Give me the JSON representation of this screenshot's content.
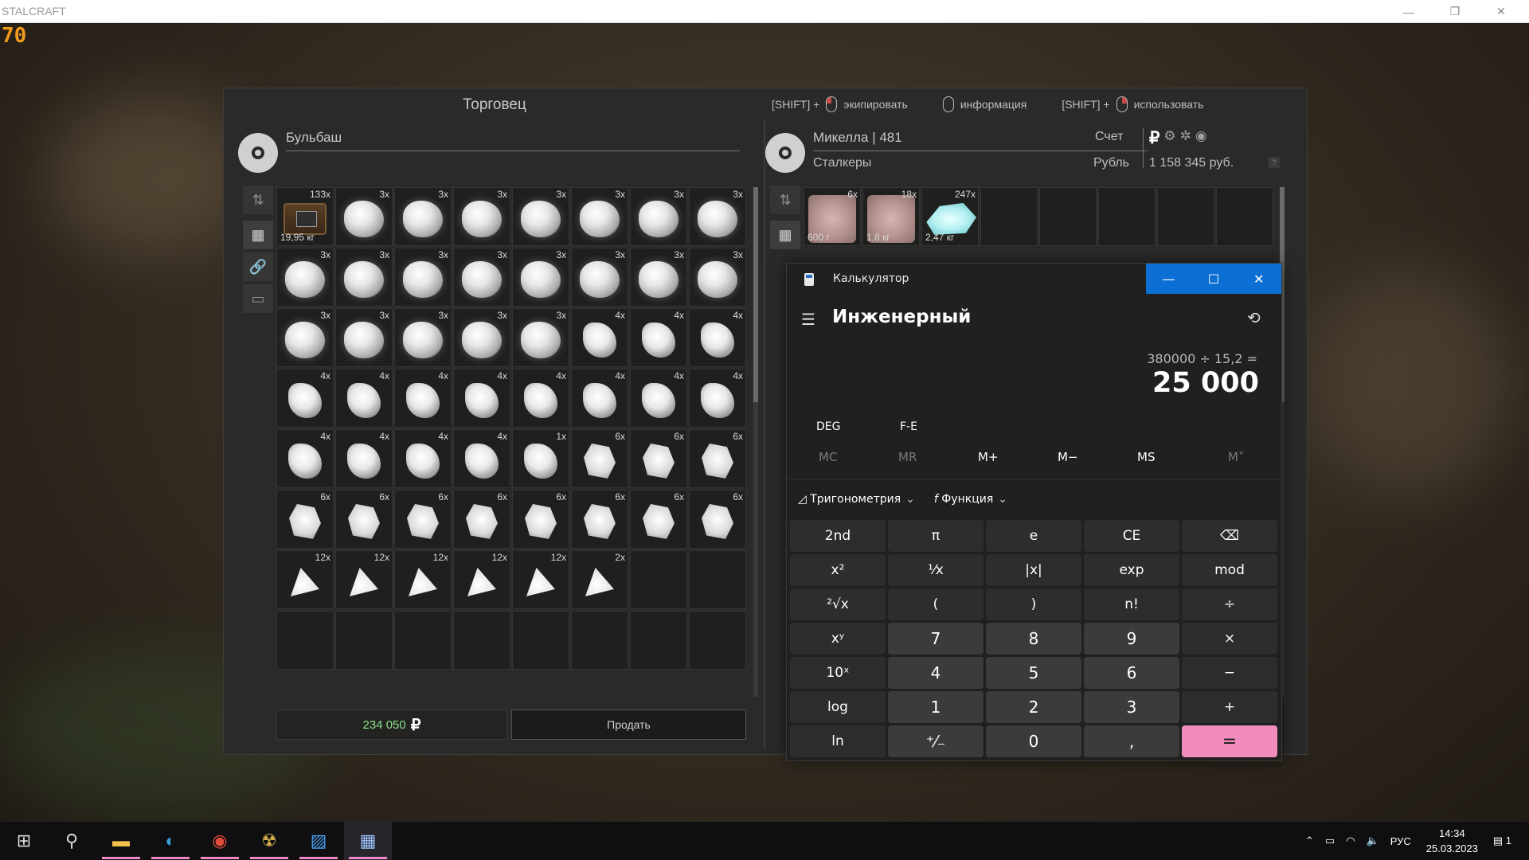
{
  "window": {
    "title": "STALCRAFT",
    "fps": "70",
    "buttons": [
      "—",
      "❐",
      "✕"
    ]
  },
  "trader": {
    "title": "Торговец",
    "npc_name": "Бульбаш",
    "total_price": "234 050",
    "currency_symbol": "₽",
    "sell_label": "Продать"
  },
  "hints": [
    {
      "prefix": "[SHIFT] +",
      "mouse": "left",
      "label": "экипировать"
    },
    {
      "prefix": "",
      "mouse": "none",
      "label": "информация"
    },
    {
      "prefix": "[SHIFT] +",
      "mouse": "right",
      "label": "использовать"
    }
  ],
  "trader_inventory": [
    {
      "kind": "box",
      "count": "133x",
      "weight": "19,95 кг"
    },
    {
      "kind": "rock",
      "count": "3x"
    },
    {
      "kind": "rock",
      "count": "3x"
    },
    {
      "kind": "rock",
      "count": "3x"
    },
    {
      "kind": "rock",
      "count": "3x"
    },
    {
      "kind": "rock",
      "count": "3x"
    },
    {
      "kind": "rock",
      "count": "3x"
    },
    {
      "kind": "rock",
      "count": "3x"
    },
    {
      "kind": "rock",
      "count": "3x"
    },
    {
      "kind": "rock",
      "count": "3x"
    },
    {
      "kind": "rock",
      "count": "3x"
    },
    {
      "kind": "rock",
      "count": "3x"
    },
    {
      "kind": "rock",
      "count": "3x"
    },
    {
      "kind": "rock",
      "count": "3x"
    },
    {
      "kind": "rock",
      "count": "3x"
    },
    {
      "kind": "rock",
      "count": "3x"
    },
    {
      "kind": "rock",
      "count": "3x"
    },
    {
      "kind": "rock",
      "count": "3x"
    },
    {
      "kind": "rock",
      "count": "3x"
    },
    {
      "kind": "rock",
      "count": "3x"
    },
    {
      "kind": "rock",
      "count": "3x"
    },
    {
      "kind": "shard",
      "count": "4x"
    },
    {
      "kind": "shard",
      "count": "4x"
    },
    {
      "kind": "shard",
      "count": "4x"
    },
    {
      "kind": "shard",
      "count": "4x"
    },
    {
      "kind": "shard",
      "count": "4x"
    },
    {
      "kind": "shard",
      "count": "4x"
    },
    {
      "kind": "shard",
      "count": "4x"
    },
    {
      "kind": "shard",
      "count": "4x"
    },
    {
      "kind": "shard",
      "count": "4x"
    },
    {
      "kind": "shard",
      "count": "4x"
    },
    {
      "kind": "shard",
      "count": "4x"
    },
    {
      "kind": "shard",
      "count": "4x"
    },
    {
      "kind": "shard",
      "count": "4x"
    },
    {
      "kind": "shard",
      "count": "4x"
    },
    {
      "kind": "shard",
      "count": "4x"
    },
    {
      "kind": "shard",
      "count": "1x"
    },
    {
      "kind": "chunk",
      "count": "6x"
    },
    {
      "kind": "chunk",
      "count": "6x"
    },
    {
      "kind": "chunk",
      "count": "6x"
    },
    {
      "kind": "chunk",
      "count": "6x"
    },
    {
      "kind": "chunk",
      "count": "6x"
    },
    {
      "kind": "chunk",
      "count": "6x"
    },
    {
      "kind": "chunk",
      "count": "6x"
    },
    {
      "kind": "chunk",
      "count": "6x"
    },
    {
      "kind": "chunk",
      "count": "6x"
    },
    {
      "kind": "chunk",
      "count": "6x"
    },
    {
      "kind": "chunk",
      "count": "6x"
    },
    {
      "kind": "tri",
      "count": "12x"
    },
    {
      "kind": "tri",
      "count": "12x"
    },
    {
      "kind": "tri",
      "count": "12x"
    },
    {
      "kind": "tri",
      "count": "12x"
    },
    {
      "kind": "tri",
      "count": "12x"
    },
    {
      "kind": "tri",
      "count": "2x"
    }
  ],
  "player": {
    "name": "Микелла | 481",
    "group": "Сталкеры",
    "account_label": "Счет",
    "currency_label": "Рубль",
    "balance": "1 158 345 руб.",
    "help": "?"
  },
  "player_inventory": [
    {
      "kind": "pink",
      "count": "6x",
      "weight": "600 г"
    },
    {
      "kind": "pink",
      "count": "18x",
      "weight": "1,8 кг"
    },
    {
      "kind": "crystal",
      "count": "247x",
      "weight": "2,47 кг"
    }
  ],
  "calculator": {
    "app_title": "Калькулятор",
    "mode": "Инженерный",
    "expression": "380000 ÷ 15,2 =",
    "display": "25 000",
    "deg": "DEG",
    "fe": "F-E",
    "memory": [
      "MC",
      "MR",
      "M+",
      "M−",
      "MS",
      "M˅"
    ],
    "trig_label": "Тригонометрия",
    "func_label": "Функция",
    "keys": [
      "2nd",
      "π",
      "e",
      "CE",
      "⌫",
      "x²",
      "¹⁄x",
      "|x|",
      "exp",
      "mod",
      "²√x",
      "(",
      ")",
      "n!",
      "÷",
      "xʸ",
      "7",
      "8",
      "9",
      "×",
      "10ˣ",
      "4",
      "5",
      "6",
      "−",
      "log",
      "1",
      "2",
      "3",
      "+",
      "ln",
      "⁺⁄₋",
      "0",
      ",",
      "="
    ]
  },
  "taskbar": {
    "apps": [
      "windows-start",
      "search",
      "file-explorer",
      "edge",
      "chrome",
      "stalcraft",
      "photos",
      "calculator"
    ],
    "language": "РУС",
    "time": "14:34",
    "date": "25.03.2023",
    "notification_count": "1"
  }
}
